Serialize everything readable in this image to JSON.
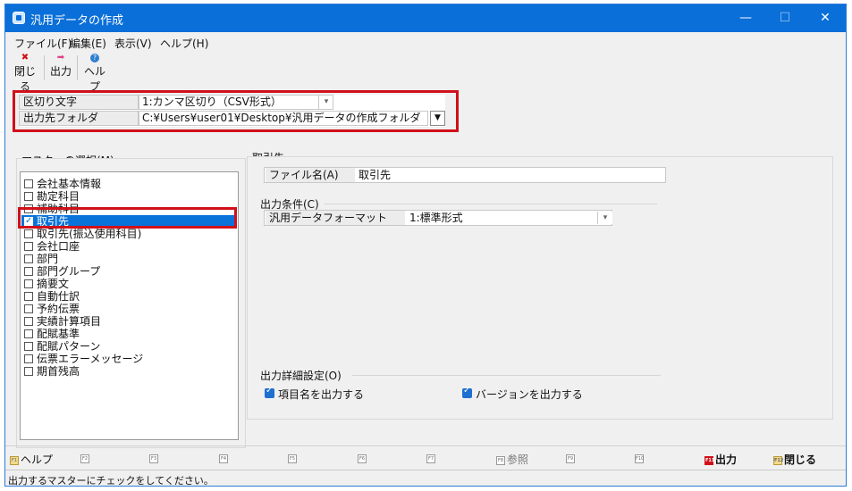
{
  "window": {
    "title": "汎用データの作成",
    "minimize": "—",
    "maximize": "☐",
    "close": "✕"
  },
  "menu": [
    "ファイル(F)",
    "編集(E)",
    "表示(V)",
    "ヘルプ(H)"
  ],
  "toolbar": {
    "close_label": "閉じる",
    "output_label": "出力",
    "help_label": "ヘルプ",
    "close_icon": "✖",
    "output_icon": "➡",
    "help_icon": "?"
  },
  "settings": {
    "delimiter_label": "区切り文字",
    "delimiter_value": "1:カンマ区切り（CSV形式）",
    "folder_label": "出力先フォルダ",
    "folder_value": "C:¥Users¥user01¥Desktop¥汎用データの作成フォルダ"
  },
  "master": {
    "title": "マスターの選択(M)",
    "items": [
      {
        "label": "会社基本情報",
        "checked": false
      },
      {
        "label": "勘定科目",
        "checked": false
      },
      {
        "label": "補助科目",
        "checked": false
      },
      {
        "label": "取引先",
        "checked": true
      },
      {
        "label": "取引先(振込使用科目)",
        "checked": false
      },
      {
        "label": "会社口座",
        "checked": false
      },
      {
        "label": "部門",
        "checked": false
      },
      {
        "label": "部門グループ",
        "checked": false
      },
      {
        "label": "摘要文",
        "checked": false
      },
      {
        "label": "自動仕訳",
        "checked": false
      },
      {
        "label": "予約伝票",
        "checked": false
      },
      {
        "label": "実績計算項目",
        "checked": false
      },
      {
        "label": "配賦基準",
        "checked": false
      },
      {
        "label": "配賦パターン",
        "checked": false
      },
      {
        "label": "伝票エラーメッセージ",
        "checked": false
      },
      {
        "label": "期首残高",
        "checked": false
      }
    ]
  },
  "detail": {
    "title": "取引先",
    "filename_label": "ファイル名(A)",
    "filename_value": "取引先",
    "conditions_title": "出力条件(C)",
    "format_label": "汎用データフォーマット",
    "format_value": "1:標準形式",
    "detail_settings_title": "出力詳細設定(O)",
    "opt_item_names": "項目名を出力する",
    "opt_version": "バージョンを出力する"
  },
  "fkeys": {
    "f1_label": "ヘルプ",
    "f1_key": "F1",
    "f2_key": "F2",
    "f3_key": "F3",
    "f4_key": "F4",
    "f5_key": "F5",
    "f6_key": "F6",
    "f7_key": "F7",
    "f8_key": "F8",
    "f8_label": "参照",
    "f9_key": "F9",
    "f10_key": "F10",
    "f11_key": "F11",
    "f11_label": "出力",
    "f12_key": "F12",
    "f12_label": "閉じる"
  },
  "status": "出力するマスターにチェックをしてください。",
  "colors": {
    "titlebar": "#0a6fd8",
    "selection": "#0a73d9",
    "highlight": "#d0101a"
  }
}
